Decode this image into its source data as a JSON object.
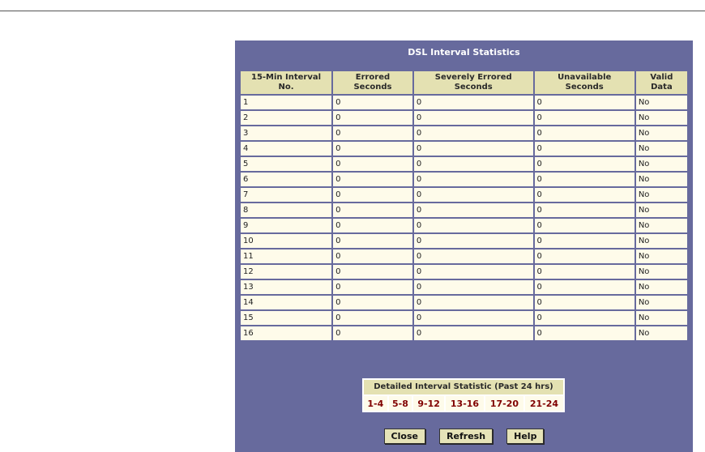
{
  "panel": {
    "title": "DSL Interval Statistics"
  },
  "table": {
    "headers": [
      "15-Min Interval\nNo.",
      "Errored\nSeconds",
      "Severely Errored\nSeconds",
      "Unavailable\nSeconds",
      "Valid\nData"
    ],
    "rows": [
      [
        "1",
        "0",
        "0",
        "0",
        "No"
      ],
      [
        "2",
        "0",
        "0",
        "0",
        "No"
      ],
      [
        "3",
        "0",
        "0",
        "0",
        "No"
      ],
      [
        "4",
        "0",
        "0",
        "0",
        "No"
      ],
      [
        "5",
        "0",
        "0",
        "0",
        "No"
      ],
      [
        "6",
        "0",
        "0",
        "0",
        "No"
      ],
      [
        "7",
        "0",
        "0",
        "0",
        "No"
      ],
      [
        "8",
        "0",
        "0",
        "0",
        "No"
      ],
      [
        "9",
        "0",
        "0",
        "0",
        "No"
      ],
      [
        "10",
        "0",
        "0",
        "0",
        "No"
      ],
      [
        "11",
        "0",
        "0",
        "0",
        "No"
      ],
      [
        "12",
        "0",
        "0",
        "0",
        "No"
      ],
      [
        "13",
        "0",
        "0",
        "0",
        "No"
      ],
      [
        "14",
        "0",
        "0",
        "0",
        "No"
      ],
      [
        "15",
        "0",
        "0",
        "0",
        "No"
      ],
      [
        "16",
        "0",
        "0",
        "0",
        "No"
      ]
    ]
  },
  "detail": {
    "title": "Detailed Interval Statistic (Past 24 hrs)",
    "links": [
      "1-4",
      "5-8",
      "9-12",
      "13-16",
      "17-20",
      "21-24"
    ]
  },
  "buttons": {
    "close": "Close",
    "refresh": "Refresh",
    "help": "Help"
  },
  "colors": {
    "panel_bg": "#676a9d",
    "header_bg": "#e4e1b2",
    "cell_bg": "#fefbea",
    "link_color": "#800000"
  }
}
